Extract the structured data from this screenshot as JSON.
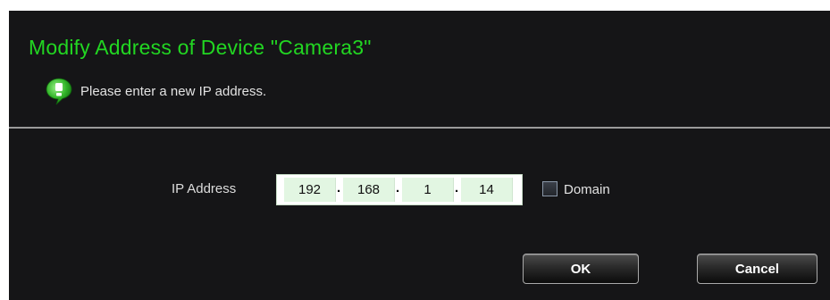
{
  "dialog": {
    "title": "Modify Address of Device \"Camera3\"",
    "info_icon": "info-bubble-icon",
    "info_text": "Please enter a new IP address."
  },
  "form": {
    "ip_label": "IP Address",
    "ip_octets": [
      "192",
      "168",
      "1",
      "14"
    ],
    "ip_separator": ".",
    "domain_checked": false,
    "domain_label": "Domain"
  },
  "buttons": {
    "ok_label": "OK",
    "cancel_label": "Cancel"
  },
  "colors": {
    "background": "#151517",
    "title": "#22d622",
    "field_cell": "#e2f6e2"
  }
}
